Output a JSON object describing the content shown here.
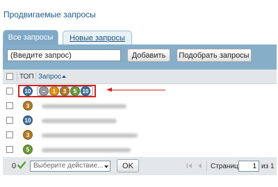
{
  "page_title": "Продвигаемые запросы",
  "tabs": [
    {
      "label": "Все запросы",
      "active": true
    },
    {
      "label": "Новые запросы",
      "active": false
    }
  ],
  "toolbar": {
    "query_value": "(Введите запрос)",
    "add_label": "Добавить",
    "pick_label": "Подобрать запросы"
  },
  "table": {
    "columns": [
      "ТОП",
      "Запрос"
    ],
    "sort": "ascending",
    "rows": [
      {
        "top": "10",
        "top_color": "#3f6e98",
        "highlighted": true,
        "positions": [
          {
            "label": "–",
            "color": "#9a9a9a"
          },
          {
            "label": "1",
            "color": "#e58e14"
          },
          {
            "label": "3",
            "color": "#b07a2a"
          },
          {
            "label": "5",
            "color": "#6f9a3c"
          },
          {
            "label": "10",
            "color": "#3f6e98"
          }
        ]
      },
      {
        "top": "3",
        "top_color": "#b07a2a"
      },
      {
        "top": "10",
        "top_color": "#3f6e98"
      },
      {
        "top": "3",
        "top_color": "#b07a2a"
      },
      {
        "top": "5",
        "top_color": "#6f9a3c"
      }
    ]
  },
  "footer": {
    "selected_count": "0",
    "check_icon": "check-icon",
    "action_placeholder": "Выберите действие...",
    "ok_label": "OK",
    "page_label": "Страница",
    "page_value": "1",
    "of_label": "из 1"
  },
  "colors": {
    "panel": "#87aec9",
    "active_tab": "#7fa9c6",
    "highlight": "#d42020"
  }
}
